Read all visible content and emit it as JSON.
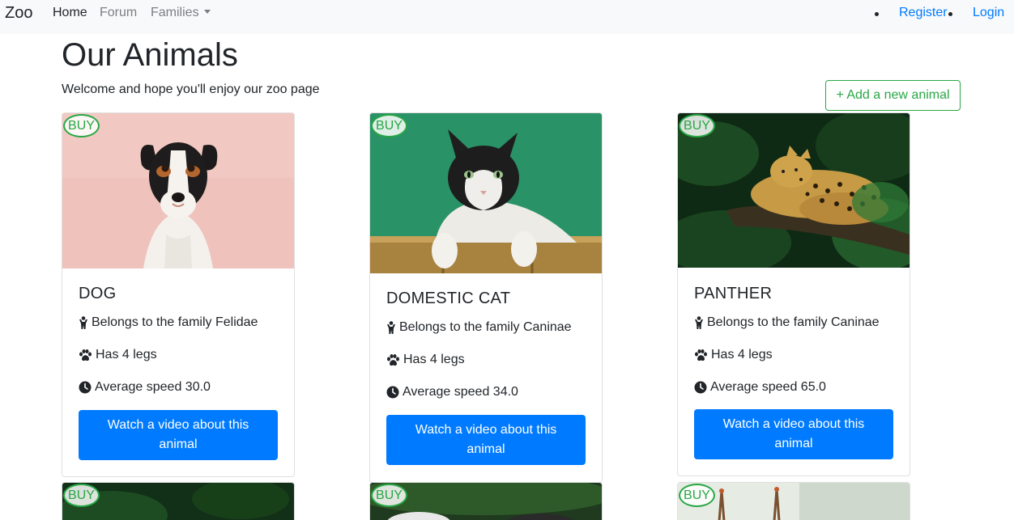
{
  "nav": {
    "brand": "Zoo",
    "links": [
      "Home",
      "Forum",
      "Families"
    ],
    "register": "Register",
    "login": "Login"
  },
  "header": {
    "title": "Our Animals",
    "subtitle": "Welcome and hope you'll enjoy our zoo page",
    "add_button": "+ Add a new animal"
  },
  "card_labels": {
    "buy": "BUY",
    "video_button": "Watch a video about this animal"
  },
  "animals": [
    {
      "name": "DOG",
      "family": "Belongs to the family Felidae",
      "legs": "Has 4 legs",
      "speed": "Average speed 30.0"
    },
    {
      "name": "DOMESTIC CAT",
      "family": "Belongs to the family Caninae",
      "legs": "Has 4 legs",
      "speed": "Average speed 34.0"
    },
    {
      "name": "PANTHER",
      "family": "Belongs to the family Caninae",
      "legs": "Has 4 legs",
      "speed": "Average speed 65.0"
    }
  ],
  "icons": {
    "family": "person-icon",
    "legs": "paw-icon",
    "speed": "clock-icon"
  },
  "colors": {
    "primary": "#007bff",
    "success": "#28a745",
    "navbar_bg": "#f8f9fa"
  }
}
